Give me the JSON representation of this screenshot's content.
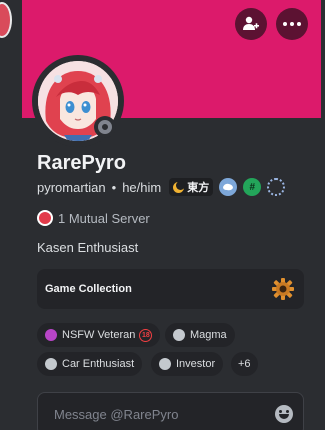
{
  "profile": {
    "display_name": "RarePyro",
    "username": "pyromartian",
    "pronouns": "he/him",
    "separator": "•",
    "guild_tag": "東方",
    "mutual_servers": "1 Mutual Server",
    "bio": "Kasen Enthusiast",
    "status": "offline"
  },
  "widget": {
    "label": "Game Collection",
    "icon": "gear-icon"
  },
  "roles": {
    "items": [
      {
        "label": "NSFW Veteran",
        "color": "#b845c7"
      },
      {
        "label": "Magma",
        "color": "#c4c9ce"
      },
      {
        "label": "Car Enthusiast",
        "color": "#c4c9ce"
      },
      {
        "label": "Investor",
        "color": "#c4c9ce"
      }
    ],
    "age_badge": "18",
    "more": "+6"
  },
  "message": {
    "placeholder": "Message @RarePyro"
  },
  "colors": {
    "banner": "#dc1a6b",
    "card": "#2b2d31",
    "button_bg": "#5c1232"
  }
}
